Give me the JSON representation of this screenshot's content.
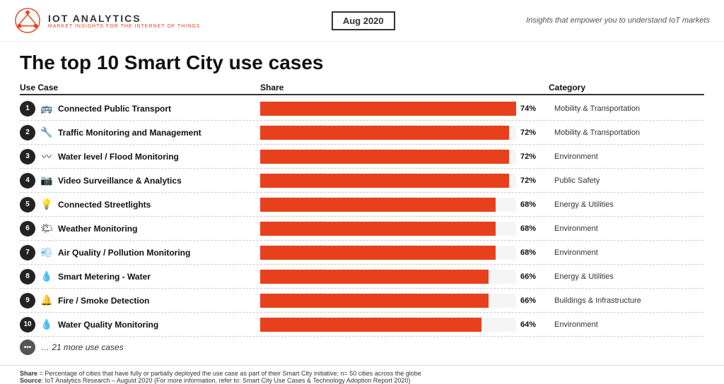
{
  "header": {
    "logo_title": "IOT  ANALYTICS",
    "logo_subtitle": "MARKET INSIGHTS FOR THE INTERNET OF THINGS",
    "date": "Aug 2020",
    "tagline": "Insights that empower you to understand IoT markets"
  },
  "page_title": "The top 10 Smart City use cases",
  "columns": {
    "use_case": "Use Case",
    "share": "Share",
    "category": "Category"
  },
  "rows": [
    {
      "rank": "1",
      "icon": "🚌",
      "name": "Connected Public Transport",
      "pct": 74,
      "pct_label": "74%",
      "category": "Mobility & Transportation"
    },
    {
      "rank": "2",
      "icon": "🔧",
      "name": "Traffic Monitoring and Management",
      "pct": 72,
      "pct_label": "72%",
      "category": "Mobility & Transportation"
    },
    {
      "rank": "3",
      "icon": "〰",
      "name": "Water level / Flood Monitoring",
      "pct": 72,
      "pct_label": "72%",
      "category": "Environment"
    },
    {
      "rank": "4",
      "icon": "📷",
      "name": "Video Surveillance & Analytics",
      "pct": 72,
      "pct_label": "72%",
      "category": "Public Safety"
    },
    {
      "rank": "5",
      "icon": "💡",
      "name": "Connected Streetlights",
      "pct": 68,
      "pct_label": "68%",
      "category": "Energy & Utilities"
    },
    {
      "rank": "6",
      "icon": "🌤",
      "name": "Weather Monitoring",
      "pct": 68,
      "pct_label": "68%",
      "category": "Environment"
    },
    {
      "rank": "7",
      "icon": "💨",
      "name": "Air Quality / Pollution Monitoring",
      "pct": 68,
      "pct_label": "68%",
      "category": "Environment"
    },
    {
      "rank": "8",
      "icon": "💧",
      "name": "Smart Metering - Water",
      "pct": 66,
      "pct_label": "66%",
      "category": "Energy & Utilities"
    },
    {
      "rank": "9",
      "icon": "🔔",
      "name": "Fire / Smoke Detection",
      "pct": 66,
      "pct_label": "66%",
      "category": "Buildings & Infrastructure"
    },
    {
      "rank": "10",
      "icon": "💧",
      "name": "Water Quality Monitoring",
      "pct": 64,
      "pct_label": "64%",
      "category": "Environment"
    }
  ],
  "more_label": "… 21 more use cases",
  "footer": {
    "share_label": "Share",
    "share_text": " = Percentage of cities that have fully or partially deployed the use case as part of their Smart City initiative; n= 50 cities across the globe",
    "source_label": "Source",
    "source_text": ": IoT Analytics Research – August 2020 (For more information, refer to: Smart City Use Cases & Technology Adoption Report 2020)"
  }
}
